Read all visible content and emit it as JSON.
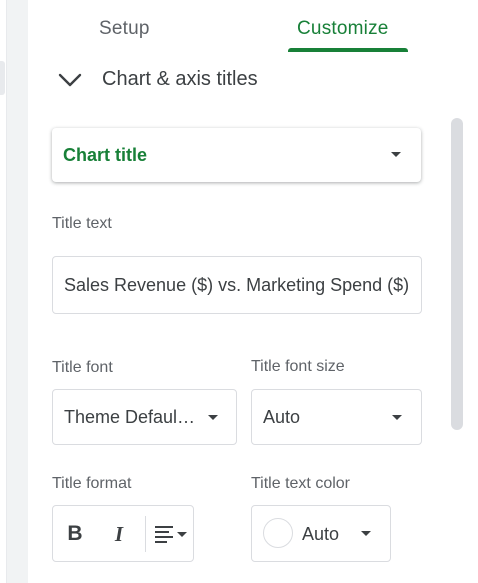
{
  "tabs": {
    "setup": "Setup",
    "customize": "Customize",
    "active": "customize"
  },
  "section": {
    "title": "Chart & axis titles",
    "expanded": true
  },
  "title_type_select": {
    "value": "Chart title"
  },
  "title_text": {
    "label": "Title text",
    "value": "Sales Revenue ($) vs. Marketing Spend ($)"
  },
  "title_font": {
    "label": "Title font",
    "value": "Theme Defaul…"
  },
  "title_font_size": {
    "label": "Title font size",
    "value": "Auto"
  },
  "title_format": {
    "label": "Title format",
    "bold": "B",
    "italic": "I"
  },
  "title_text_color": {
    "label": "Title text color",
    "value": "Auto",
    "swatch_color": "#ffffff"
  },
  "icons": [
    "chevron-down-icon",
    "dropdown-caret-icon",
    "bold-icon",
    "italic-icon",
    "align-left-icon"
  ],
  "colors": {
    "accent": "#188038",
    "text": "#3c4043",
    "muted": "#5f6368",
    "border": "#dadce0"
  }
}
